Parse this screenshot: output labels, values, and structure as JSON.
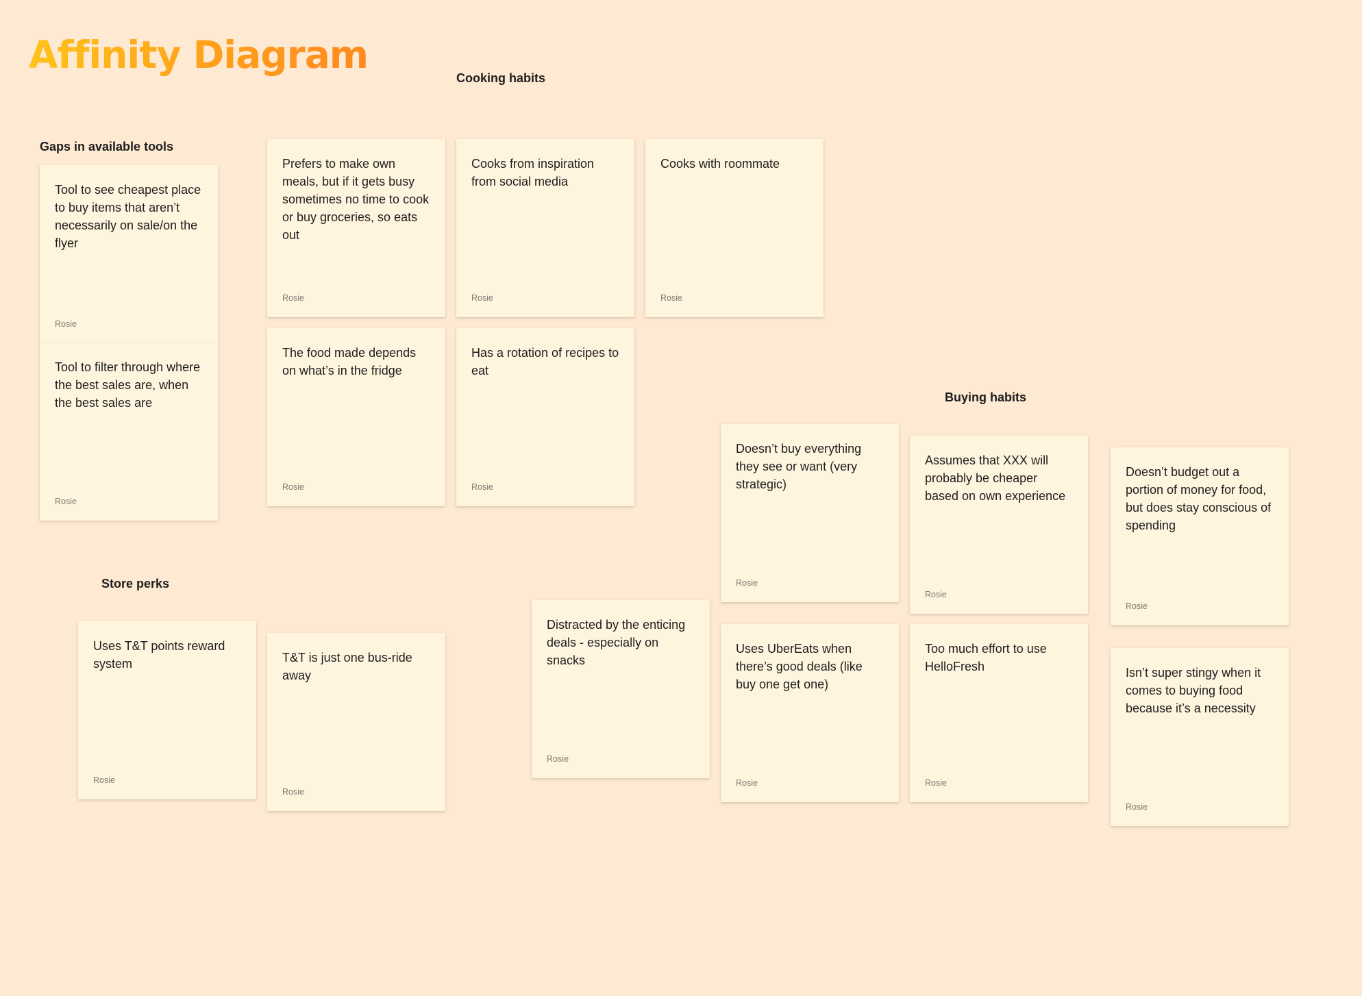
{
  "title": "Affinity Diagram",
  "groups": {
    "gaps": {
      "label": "Gaps in available tools",
      "notes": [
        {
          "text": "Tool to see cheapest place to buy items that aren’t necessarily on sale/on the flyer",
          "author": "Rosie"
        },
        {
          "text": "Tool to filter through where the best sales are, when the best sales are",
          "author": "Rosie"
        }
      ]
    },
    "cooking": {
      "label": "Cooking habits",
      "notes": [
        {
          "text": "Prefers to make own meals, but if it gets busy sometimes no time to cook or buy groceries, so eats out",
          "author": "Rosie"
        },
        {
          "text": "Cooks from inspiration from social media",
          "author": "Rosie"
        },
        {
          "text": "Cooks with roommate",
          "author": "Rosie"
        },
        {
          "text": "The food made depends on what’s in the fridge",
          "author": "Rosie"
        },
        {
          "text": "Has a rotation of recipes to eat",
          "author": "Rosie"
        }
      ]
    },
    "store_perks": {
      "label": "Store perks",
      "notes": [
        {
          "text": "Uses T&T points reward system",
          "author": "Rosie"
        },
        {
          "text": "T&T is just one bus-ride away",
          "author": "Rosie"
        }
      ]
    },
    "buying": {
      "label": "Buying habits",
      "notes": [
        {
          "text": "Distracted by the enticing deals - especially on snacks",
          "author": "Rosie"
        },
        {
          "text": "Doesn’t buy everything they see or want (very strategic)",
          "author": "Rosie"
        },
        {
          "text": "Assumes that XXX will probably be cheaper based on own experience",
          "author": "Rosie"
        },
        {
          "text": "Doesn’t budget out a portion of money for food, but does stay conscious of spending",
          "author": "Rosie"
        },
        {
          "text": "Uses UberEats when there’s good deals (like buy one get one)",
          "author": "Rosie"
        },
        {
          "text": "Too much effort to use HelloFresh",
          "author": "Rosie"
        },
        {
          "text": "Isn’t super stingy when it comes to buying food because it’s a necessity",
          "author": "Rosie"
        }
      ]
    }
  },
  "colors": {
    "canvas": "#fee9d2",
    "sticky": "#fff4de",
    "title_start": "#ffc21a",
    "title_end": "#ff8a1f"
  }
}
